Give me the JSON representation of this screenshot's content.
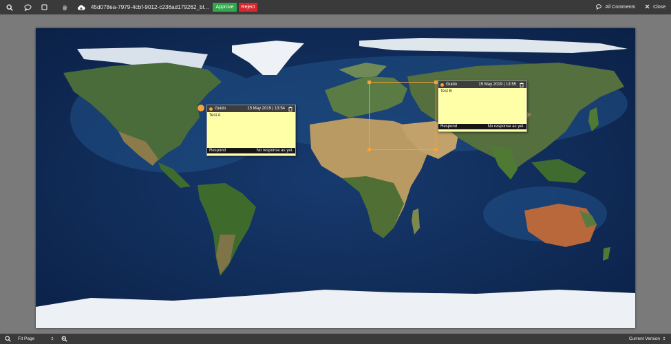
{
  "toolbar": {
    "filename": "45d078ea-7979-4cbf-9012-c236ad179262_bl...",
    "approve_label": "Approve",
    "reject_label": "Reject",
    "all_comments_label": "All Comments",
    "close_label": "Close",
    "icons": [
      "search-icon",
      "comment-icon",
      "rectangle-icon",
      "hand-icon",
      "cloud-download-icon",
      "comments-icon",
      "close-icon"
    ]
  },
  "bottombar": {
    "zoom_value": "Fit Page",
    "version_value": "Current Version",
    "icons": [
      "zoom-out-icon",
      "zoom-in-icon"
    ]
  },
  "comments": [
    {
      "author": "Guido",
      "date": "15 May 2019 | 13:54",
      "text": "Test A",
      "respond_label": "Respond",
      "status": "No response as yet."
    },
    {
      "author": "Guido",
      "date": "15 May 2019 | 13:55",
      "text": "Test B",
      "respond_label": "Respond",
      "status": "No response as yet."
    }
  ],
  "colors": {
    "approve": "#31a84b",
    "reject": "#d7262c",
    "annotation": "#f5a23a",
    "note_background": "#ffffa8",
    "toolbar": "#3a3a3a"
  }
}
